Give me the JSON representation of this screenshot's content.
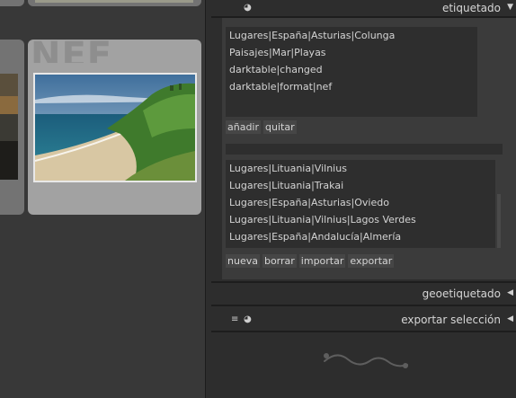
{
  "grid": {
    "thumbnail_extension_label": "NEF"
  },
  "panel": {
    "tagging": {
      "title": "etiquetado",
      "attached_tags": [
        "Lugares|España|Asturias|Colunga",
        "Paisajes|Mar|Playas",
        "darktable|changed",
        "darktable|format|nef"
      ],
      "attached_buttons": {
        "attach": "añadir",
        "detach": "quitar"
      },
      "dictionary_tags": [
        "Lugares|Lituania|Vilnius",
        "Lugares|Lituania|Trakai",
        "Lugares|España|Asturias|Oviedo",
        "Lugares|Lituania|Vilnius|Lagos Verdes",
        "Lugares|España|Andalucía|Almería"
      ],
      "dictionary_buttons": {
        "new": "nueva",
        "delete": "borrar",
        "import": "importar",
        "export": "exportar"
      }
    },
    "geotagging": {
      "title": "geoetiquetado"
    },
    "export": {
      "title": "exportar selección"
    }
  },
  "colors": {
    "panel_bg": "#2d2d2d",
    "module_bg": "#3b3b3b",
    "list_bg": "#2e2e2e",
    "selected_cell": "#a2a2a2"
  }
}
